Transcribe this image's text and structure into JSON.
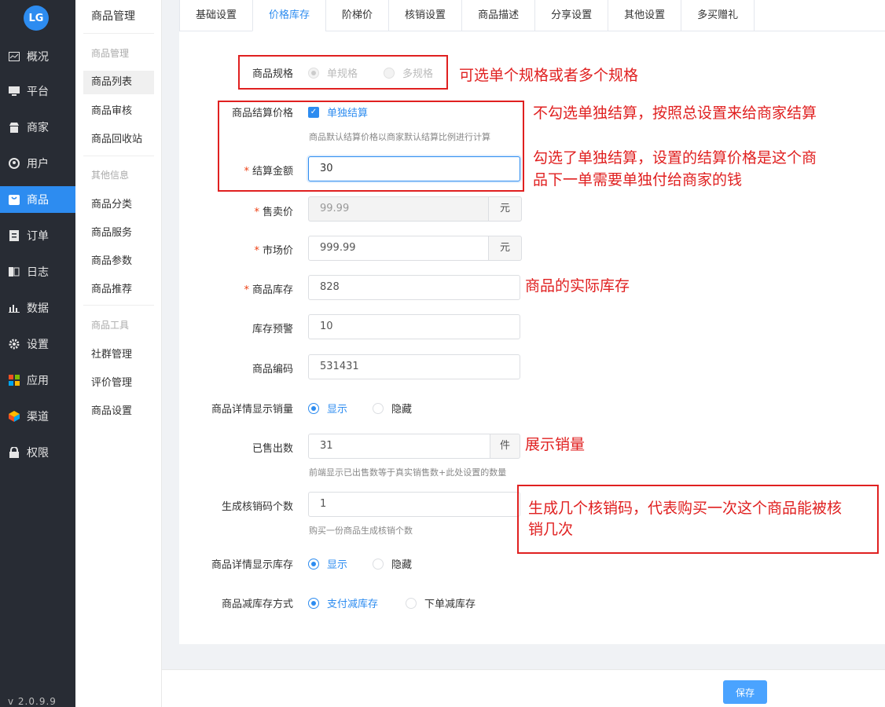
{
  "app": {
    "logo_text": "LG",
    "version": "v 2.0.9.9"
  },
  "sidebar": {
    "items": [
      {
        "label": "概况",
        "icon": "dashboard-icon"
      },
      {
        "label": "平台",
        "icon": "monitor-icon"
      },
      {
        "label": "商家",
        "icon": "store-icon"
      },
      {
        "label": "用户",
        "icon": "user-icon"
      },
      {
        "label": "商品",
        "icon": "goods-icon"
      },
      {
        "label": "订单",
        "icon": "order-icon"
      },
      {
        "label": "日志",
        "icon": "log-icon"
      },
      {
        "label": "数据",
        "icon": "chart-icon"
      },
      {
        "label": "设置",
        "icon": "gear-icon"
      },
      {
        "label": "应用",
        "icon": "apps-icon"
      },
      {
        "label": "渠道",
        "icon": "cube-icon"
      },
      {
        "label": "权限",
        "icon": "lock-icon"
      }
    ],
    "active": "商品"
  },
  "submenu": {
    "title": "商品管理",
    "group1": "商品管理",
    "group1_items": [
      "商品列表",
      "商品审核",
      "商品回收站"
    ],
    "group2": "其他信息",
    "group2_items": [
      "商品分类",
      "商品服务",
      "商品参数",
      "商品推荐"
    ],
    "group3": "商品工具",
    "group3_items": [
      "社群管理",
      "评价管理",
      "商品设置"
    ]
  },
  "tabs": [
    "基础设置",
    "价格库存",
    "阶梯价",
    "核销设置",
    "商品描述",
    "分享设置",
    "其他设置",
    "多买赠礼"
  ],
  "active_tab": "价格库存",
  "form": {
    "spec_label": "商品规格",
    "spec_single": "单规格",
    "spec_multi": "多规格",
    "settle_label": "商品结算价格",
    "settle_check": "单独结算",
    "settle_hint": "商品默认结算价格以商家默认结算比例进行计算",
    "settle_amount_label": "结算金额",
    "settle_amount_value": "30",
    "sale_price_label": "售卖价",
    "sale_price_value": "99.99",
    "market_price_label": "市场价",
    "market_price_value": "999.99",
    "currency_unit": "元",
    "stock_label": "商品库存",
    "stock_value": "828",
    "stock_warn_label": "库存预警",
    "stock_warn_value": "10",
    "code_label": "商品编码",
    "code_value": "531431",
    "show_sales_label": "商品详情显示销量",
    "show": "显示",
    "hide": "隐藏",
    "sold_label": "已售出数",
    "sold_value": "31",
    "sold_unit": "件",
    "sold_hint": "前端显示已出售数等于真实销售数+此处设置的数量",
    "verify_count_label": "生成核销码个数",
    "verify_count_value": "1",
    "verify_count_hint": "购买一份商品生成核销个数",
    "show_stock_label": "商品详情显示库存",
    "reduce_label": "商品减库存方式",
    "reduce_pay": "支付减库存",
    "reduce_order": "下单减库存"
  },
  "annotations": {
    "spec": "可选单个规格或者多个规格",
    "settle_1": "不勾选单独结算，按照总设置来给商家结算",
    "settle_2a": "勾选了单独结算，设置的结算价格是这个商",
    "settle_2b": "品下一单需要单独付给商家的钱",
    "stock": "商品的实际库存",
    "sales": "展示销量",
    "verify_a": "生成几个核销码，代表购买一次这个商品能被核",
    "verify_b": "销几次"
  },
  "save_label": "保存"
}
